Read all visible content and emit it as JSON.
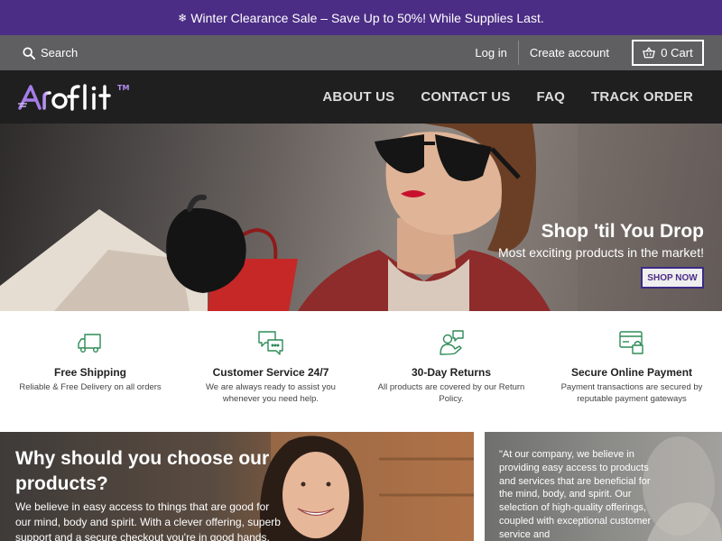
{
  "announcement": {
    "icon": "snowflake-icon",
    "text": "Winter Clearance Sale – Save Up to 50%! While Supplies Last."
  },
  "utility": {
    "search_label": "Search",
    "login": "Log in",
    "create_account": "Create account",
    "cart_label": "0 Cart"
  },
  "brand": {
    "logo_text": "Aroflit",
    "tm": "TM"
  },
  "nav": {
    "about": "ABOUT US",
    "contact": "CONTACT US",
    "faq": "FAQ",
    "track": "TRACK ORDER"
  },
  "hero": {
    "title": "Shop 'til You Drop",
    "subtitle": "Most exciting products in the market!",
    "button": "SHOP NOW"
  },
  "features": [
    {
      "icon": "truck-icon",
      "title": "Free Shipping",
      "text": "Reliable & Free Delivery on all orders"
    },
    {
      "icon": "chat-bubbles-icon",
      "title": "Customer Service 24/7",
      "text": "We are always ready to assist you whenever you need help."
    },
    {
      "icon": "returns-icon",
      "title": "30-Day Returns",
      "text": "All products are covered by our Return Policy."
    },
    {
      "icon": "secure-card-icon",
      "title": "Secure Online Payment",
      "text": "Payment transactions are secured by reputable payment gateways"
    }
  ],
  "why": {
    "title": "Why should you choose our products?",
    "text": "We believe in easy access to things that are good for our mind, body and spirit. With a clever offering, superb support and a secure checkout you're in good hands."
  },
  "quote": {
    "text": "\"At our company, we believe in providing easy access to products and services that are beneficial for the mind, body, and spirit. Our selection of high-quality offerings, coupled with exceptional customer service and"
  },
  "colors": {
    "brand_purple": "#4b2d85",
    "utility_bar": "#5f5f62",
    "nav_bar": "#1f1f1f",
    "feature_icon_green": "#2e8b57"
  }
}
